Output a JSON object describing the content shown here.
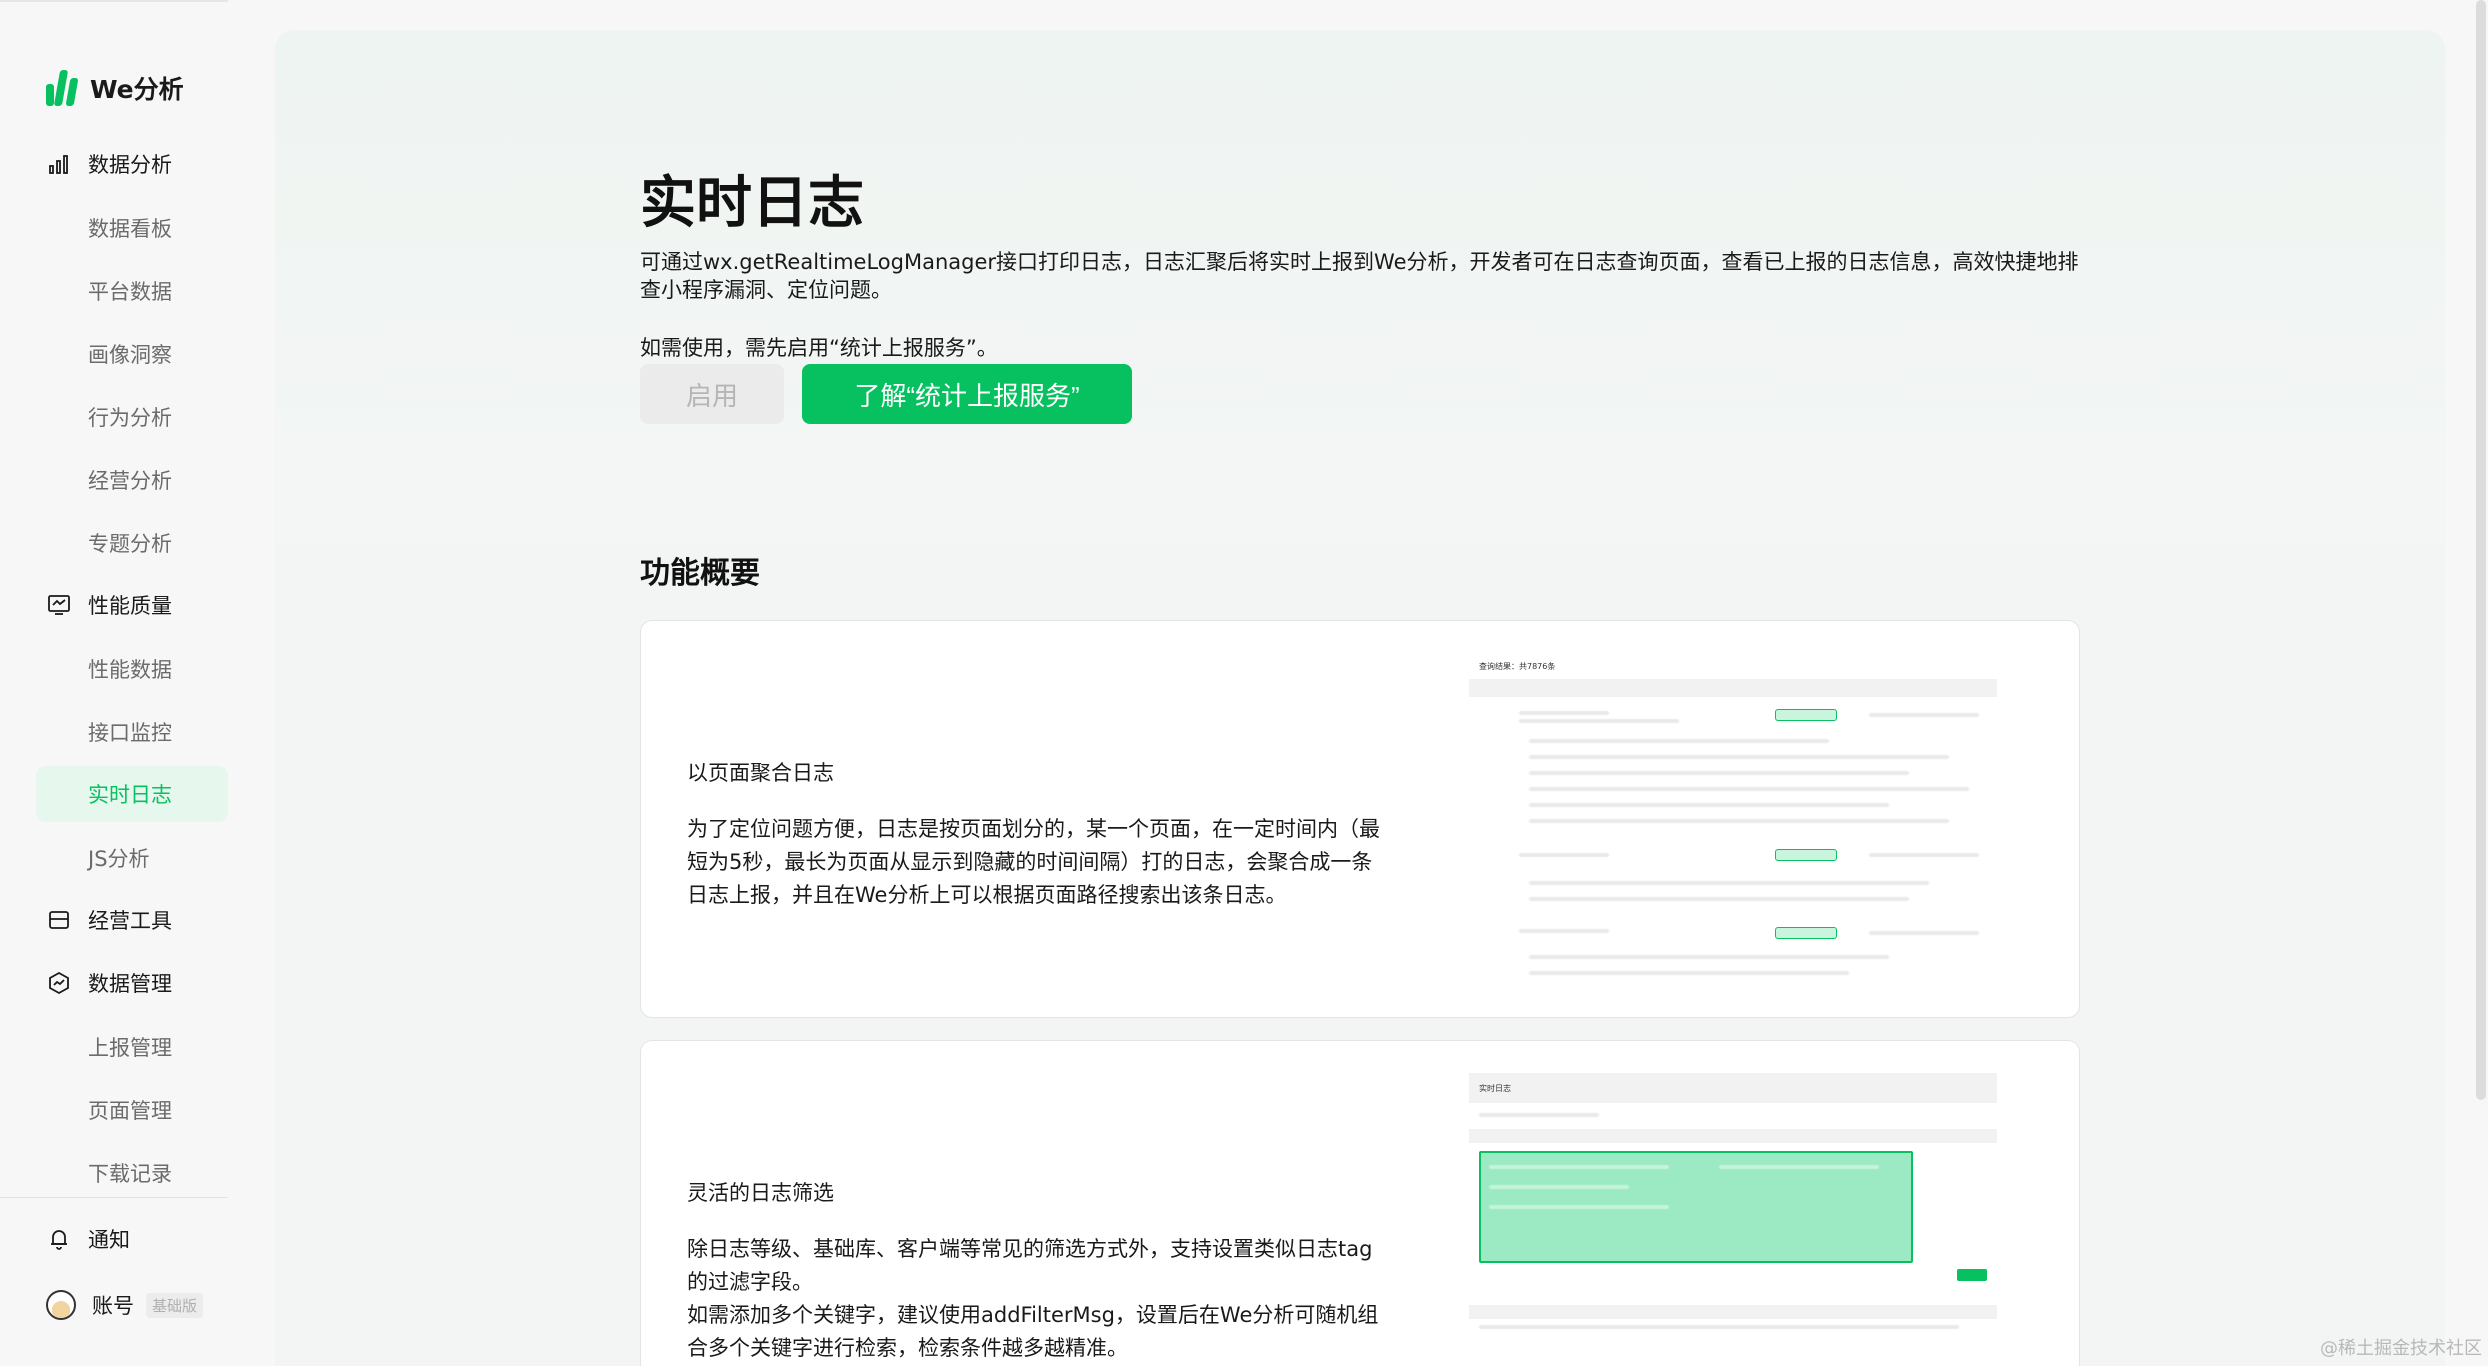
{
  "app": {
    "name": "We分析"
  },
  "sidebar": {
    "groups": [
      {
        "label": "数据分析",
        "icon": "bar-chart-icon",
        "items": [
          "数据看板",
          "平台数据",
          "画像洞察",
          "行为分析",
          "经营分析",
          "专题分析"
        ]
      },
      {
        "label": "性能质量",
        "icon": "monitor-icon",
        "items": [
          "性能数据",
          "接口监控",
          "实时日志",
          "JS分析"
        ]
      },
      {
        "label": "经营工具",
        "icon": "shop-icon",
        "items": []
      },
      {
        "label": "数据管理",
        "icon": "data-manage-icon",
        "items": [
          "上报管理",
          "页面管理",
          "下载记录"
        ]
      }
    ],
    "active_item": "实时日志",
    "notice_label": "通知",
    "account_label": "账号",
    "account_badge": "基础版"
  },
  "page": {
    "title": "实时日志",
    "description": "可通过wx.getRealtimeLogManager接口打印日志，日志汇聚后将实时上报到We分析，开发者可在日志查询页面，查看已上报的日志信息，高效快捷地排查小程序漏洞、定位问题。",
    "note": "如需使用，需先启用“统计上报服务”。",
    "enable_button": "启用",
    "learn_button": "了解“统计上报服务”",
    "section_title": "功能概要"
  },
  "features": [
    {
      "title": "以页面聚合日志",
      "text": "为了定位问题方便，日志是按页面划分的，某一个页面，在一定时间内（最短为5秒，最长为页面从显示到隐藏的时间间隔）打的日志，会聚合成一条日志上报，并且在We分析上可以根据页面路径搜索出该条日志。"
    },
    {
      "title": "灵活的日志筛选",
      "text1": "除日志等级、基础库、客户端等常见的筛选方式外，支持设置类似日志tag的过滤字段。",
      "text2": "如需添加多个关键字，建议使用addFilterMsg，设置后在We分析可随机组合多个关键字进行检索，检索条件越多越精准。"
    }
  ],
  "mock_screens": {
    "screen1_title": "查询结果：共7876条",
    "screen2_title": "实时日志"
  },
  "watermark": "@稀土掘金技术社区",
  "colors": {
    "brand": "#07c160",
    "active_bg": "#e6f7ee"
  }
}
